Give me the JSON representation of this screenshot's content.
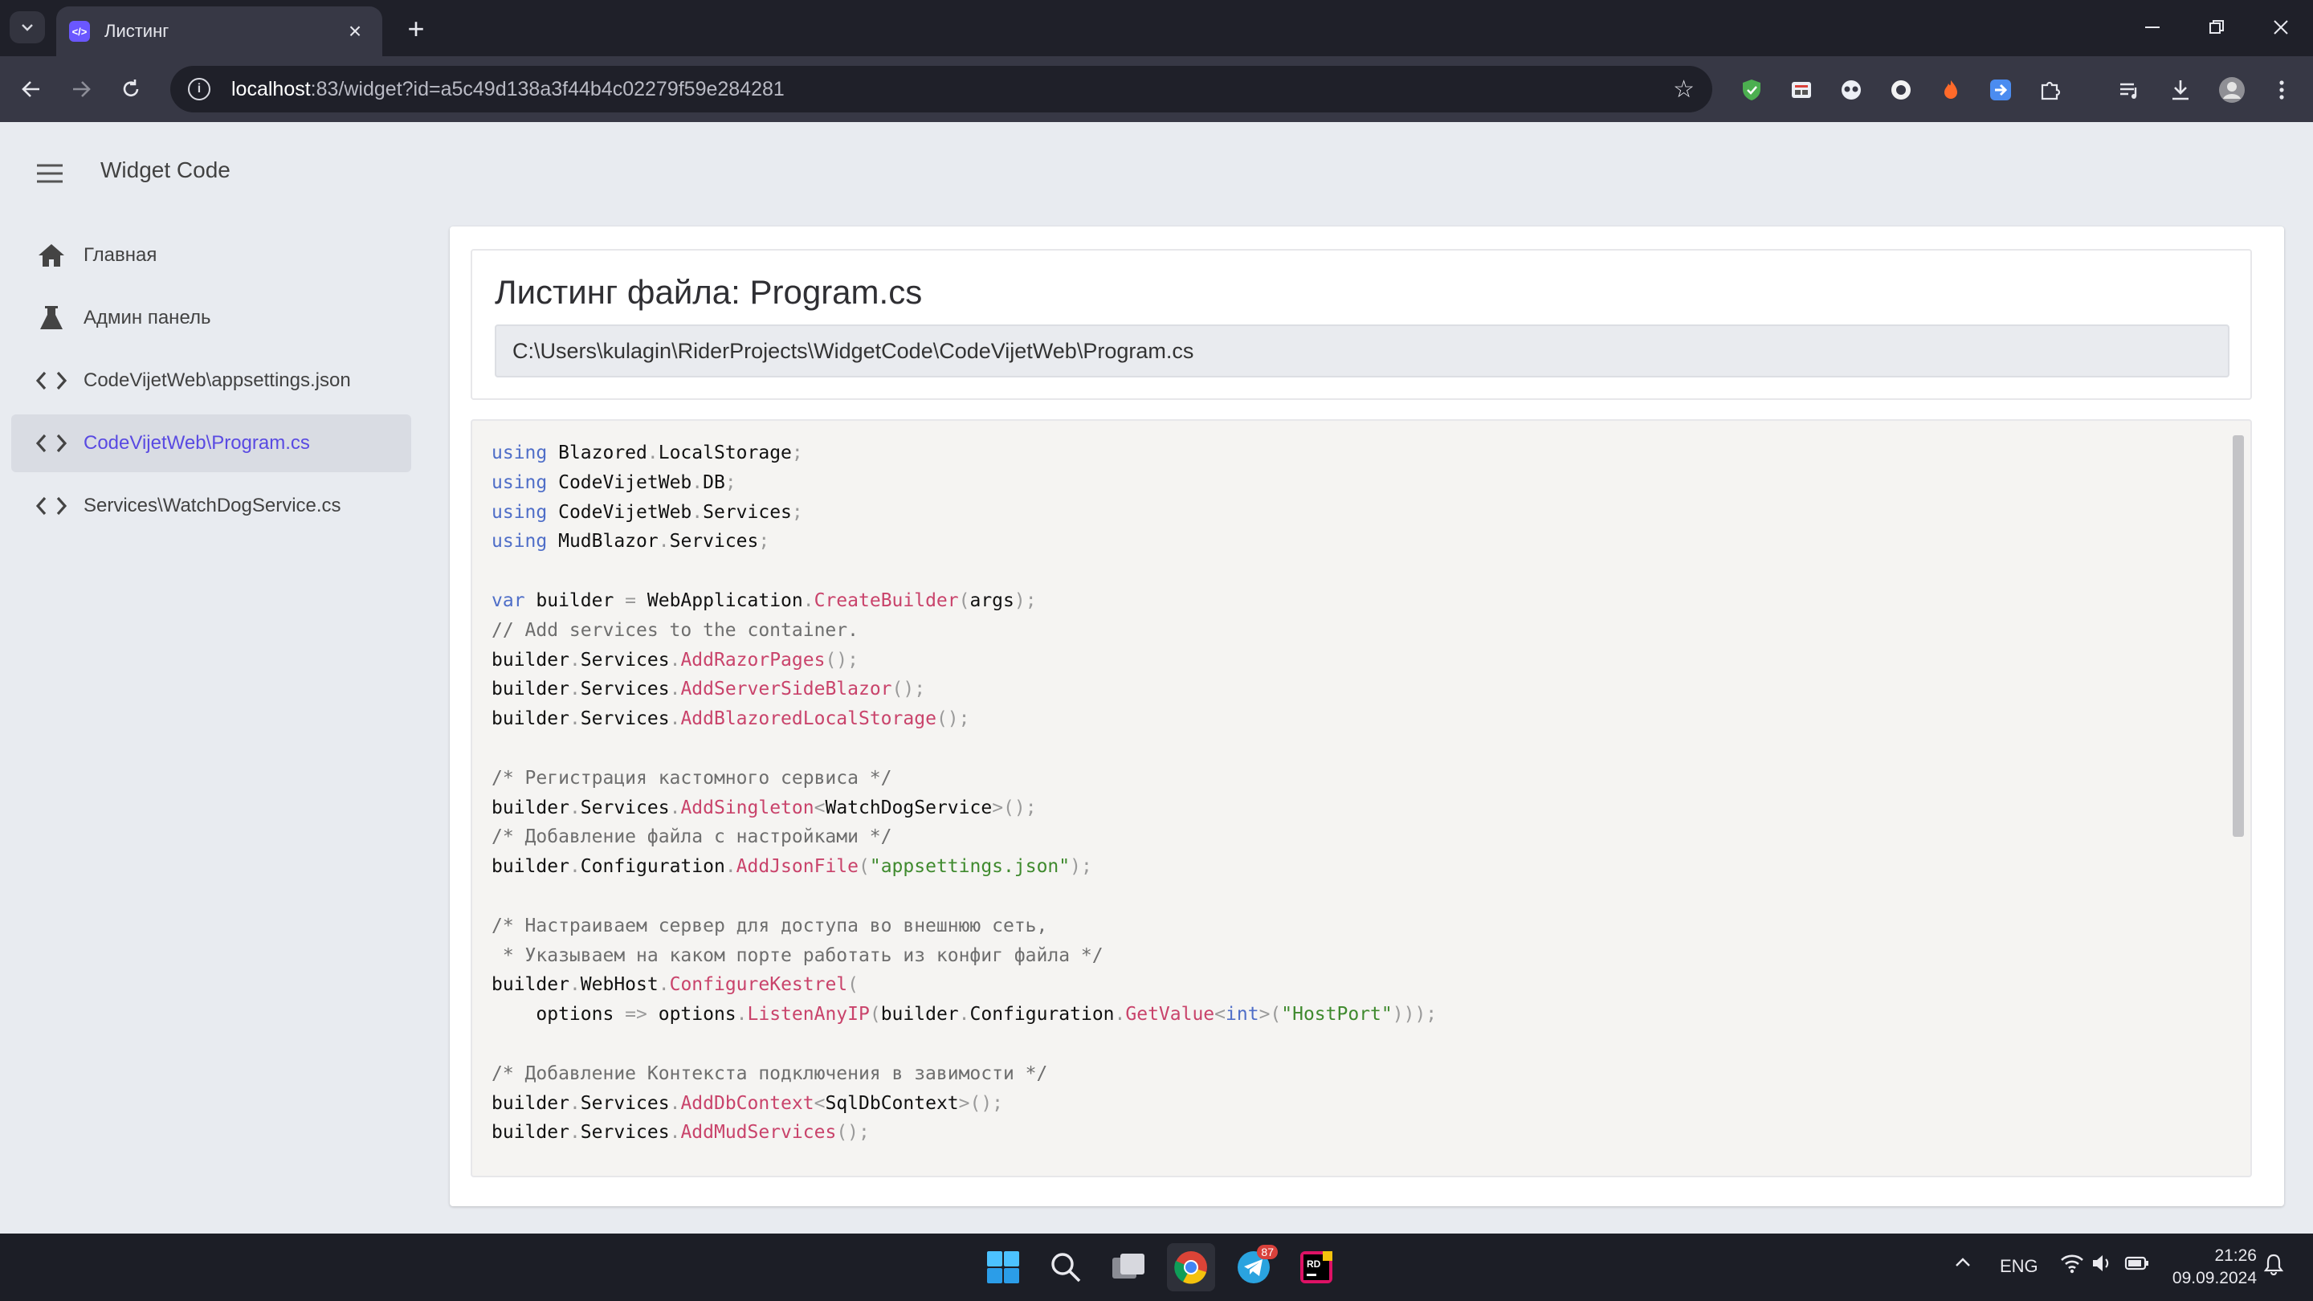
{
  "browser": {
    "tab_title": "Листинг",
    "url_host": "localhost",
    "url_rest": ":83/widget?id=a5c49d138a3f44b4c02279f59e284281"
  },
  "app": {
    "title": "Widget Code"
  },
  "sidebar": {
    "items": [
      {
        "label": "Главная",
        "icon": "home-icon",
        "active": false
      },
      {
        "label": "Админ панель",
        "icon": "flask-icon",
        "active": false
      },
      {
        "label": "CodeVijetWeb\\appsettings.json",
        "icon": "code-icon",
        "active": true
      },
      {
        "label": "CodeVijetWeb\\Program.cs",
        "icon": "code-icon",
        "active": true
      },
      {
        "label": "Services\\WatchDogService.cs",
        "icon": "code-icon",
        "active": false
      }
    ]
  },
  "listing": {
    "title": "Листинг файла: Program.cs",
    "path": "C:\\Users\\kulagin\\RiderProjects\\WidgetCode\\CodeVijetWeb\\Program.cs",
    "code_lines": [
      [
        [
          "kw",
          "using"
        ],
        [
          "id",
          " Blazored"
        ],
        [
          "pn",
          "."
        ],
        [
          "id",
          "LocalStorage"
        ],
        [
          "pn",
          ";"
        ]
      ],
      [
        [
          "kw",
          "using"
        ],
        [
          "id",
          " CodeVijetWeb"
        ],
        [
          "pn",
          "."
        ],
        [
          "id",
          "DB"
        ],
        [
          "pn",
          ";"
        ]
      ],
      [
        [
          "kw",
          "using"
        ],
        [
          "id",
          " CodeVijetWeb"
        ],
        [
          "pn",
          "."
        ],
        [
          "id",
          "Services"
        ],
        [
          "pn",
          ";"
        ]
      ],
      [
        [
          "kw",
          "using"
        ],
        [
          "id",
          " MudBlazor"
        ],
        [
          "pn",
          "."
        ],
        [
          "id",
          "Services"
        ],
        [
          "pn",
          ";"
        ]
      ],
      [],
      [
        [
          "kw",
          "var"
        ],
        [
          "id",
          " builder "
        ],
        [
          "pn",
          "="
        ],
        [
          "id",
          " WebApplication"
        ],
        [
          "pn",
          "."
        ],
        [
          "fn",
          "CreateBuilder"
        ],
        [
          "pn",
          "("
        ],
        [
          "id",
          "args"
        ],
        [
          "pn",
          ");"
        ]
      ],
      [
        [
          "cm",
          "// Add services to the container."
        ]
      ],
      [
        [
          "id",
          "builder"
        ],
        [
          "pn",
          "."
        ],
        [
          "id",
          "Services"
        ],
        [
          "pn",
          "."
        ],
        [
          "fn",
          "AddRazorPages"
        ],
        [
          "pn",
          "();"
        ]
      ],
      [
        [
          "id",
          "builder"
        ],
        [
          "pn",
          "."
        ],
        [
          "id",
          "Services"
        ],
        [
          "pn",
          "."
        ],
        [
          "fn",
          "AddServerSideBlazor"
        ],
        [
          "pn",
          "();"
        ]
      ],
      [
        [
          "id",
          "builder"
        ],
        [
          "pn",
          "."
        ],
        [
          "id",
          "Services"
        ],
        [
          "pn",
          "."
        ],
        [
          "fn",
          "AddBlazoredLocalStorage"
        ],
        [
          "pn",
          "();"
        ]
      ],
      [],
      [
        [
          "cm",
          "/* Регистрация кастомного сервиса */"
        ]
      ],
      [
        [
          "id",
          "builder"
        ],
        [
          "pn",
          "."
        ],
        [
          "id",
          "Services"
        ],
        [
          "pn",
          "."
        ],
        [
          "fn",
          "AddSingleton"
        ],
        [
          "pn",
          "<"
        ],
        [
          "id",
          "WatchDogService"
        ],
        [
          "pn",
          ">();"
        ]
      ],
      [
        [
          "cm",
          "/* Добавление файла с настройками */"
        ]
      ],
      [
        [
          "id",
          "builder"
        ],
        [
          "pn",
          "."
        ],
        [
          "id",
          "Configuration"
        ],
        [
          "pn",
          "."
        ],
        [
          "fn",
          "AddJsonFile"
        ],
        [
          "pn",
          "("
        ],
        [
          "str",
          "\"appsettings.json\""
        ],
        [
          "pn",
          ");"
        ]
      ],
      [],
      [
        [
          "cm",
          "/* Настраиваем сервер для доступа во внешнюю сеть,"
        ]
      ],
      [
        [
          "cm",
          " * Указываем на каком порте работать из конфиг файла */"
        ]
      ],
      [
        [
          "id",
          "builder"
        ],
        [
          "pn",
          "."
        ],
        [
          "id",
          "WebHost"
        ],
        [
          "pn",
          "."
        ],
        [
          "fn",
          "ConfigureKestrel"
        ],
        [
          "pn",
          "("
        ]
      ],
      [
        [
          "id",
          "    options "
        ],
        [
          "pn",
          "=>"
        ],
        [
          "id",
          " options"
        ],
        [
          "pn",
          "."
        ],
        [
          "fn",
          "ListenAnyIP"
        ],
        [
          "pn",
          "("
        ],
        [
          "id",
          "builder"
        ],
        [
          "pn",
          "."
        ],
        [
          "id",
          "Configuration"
        ],
        [
          "pn",
          "."
        ],
        [
          "fn",
          "GetValue"
        ],
        [
          "pn",
          "<"
        ],
        [
          "kw",
          "int"
        ],
        [
          "pn",
          ">("
        ],
        [
          "str",
          "\"HostPort\""
        ],
        [
          "pn",
          ")));"
        ]
      ],
      [],
      [
        [
          "cm",
          "/* Добавление Контекста подключения в завимости */"
        ]
      ],
      [
        [
          "id",
          "builder"
        ],
        [
          "pn",
          "."
        ],
        [
          "id",
          "Services"
        ],
        [
          "pn",
          "."
        ],
        [
          "fn",
          "AddDbContext"
        ],
        [
          "pn",
          "<"
        ],
        [
          "id",
          "SqlDbContext"
        ],
        [
          "pn",
          ">();"
        ]
      ],
      [
        [
          "id",
          "builder"
        ],
        [
          "pn",
          "."
        ],
        [
          "id",
          "Services"
        ],
        [
          "pn",
          "."
        ],
        [
          "fn",
          "AddMudServices"
        ],
        [
          "pn",
          "();"
        ]
      ]
    ]
  },
  "taskbar": {
    "telegram_badge": "87",
    "lang": "ENG",
    "time": "21:26",
    "date": "09.09.2024"
  },
  "colors": {
    "accent": "#594ae2",
    "keyword": "#4f6ec8",
    "method": "#c9436b",
    "string": "#3f8a2e",
    "comment": "#6e6e6e"
  }
}
